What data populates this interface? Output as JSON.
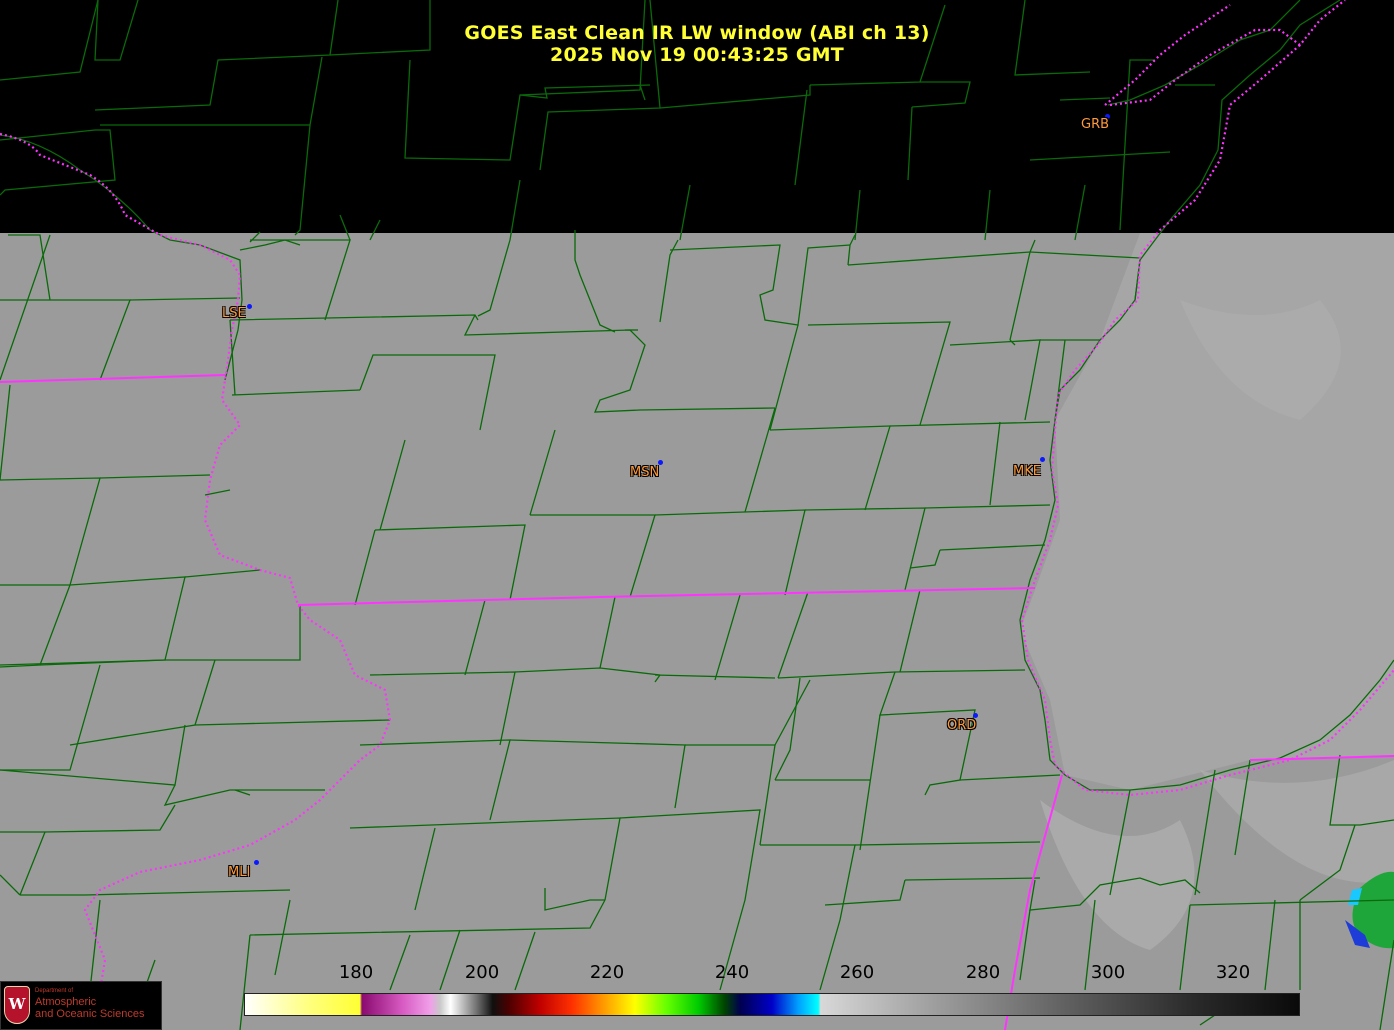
{
  "title": {
    "line1": "GOES East Clean IR LW window (ABI ch 13)",
    "line2": "2025 Nov 19  00:43:25 GMT"
  },
  "stations": [
    {
      "code": "GRB"
    },
    {
      "code": "LSE"
    },
    {
      "code": "MSN"
    },
    {
      "code": "MKE"
    },
    {
      "code": "ORD"
    },
    {
      "code": "MLI"
    }
  ],
  "colorbar": {
    "ticks": [
      "180",
      "200",
      "220",
      "240",
      "260",
      "280",
      "300",
      "320"
    ]
  },
  "logo": {
    "small_text": "Department of",
    "line1": "Atmospheric",
    "line2": "and Oceanic Sciences"
  },
  "colors": {
    "title": "#ffff33",
    "station_label": "#ff9a3c",
    "station_dot": "#0b19ff",
    "county_lines": "#0a6a0a",
    "state_lines": "#ff33ff",
    "imagery_gray": "#9a9a9a"
  }
}
